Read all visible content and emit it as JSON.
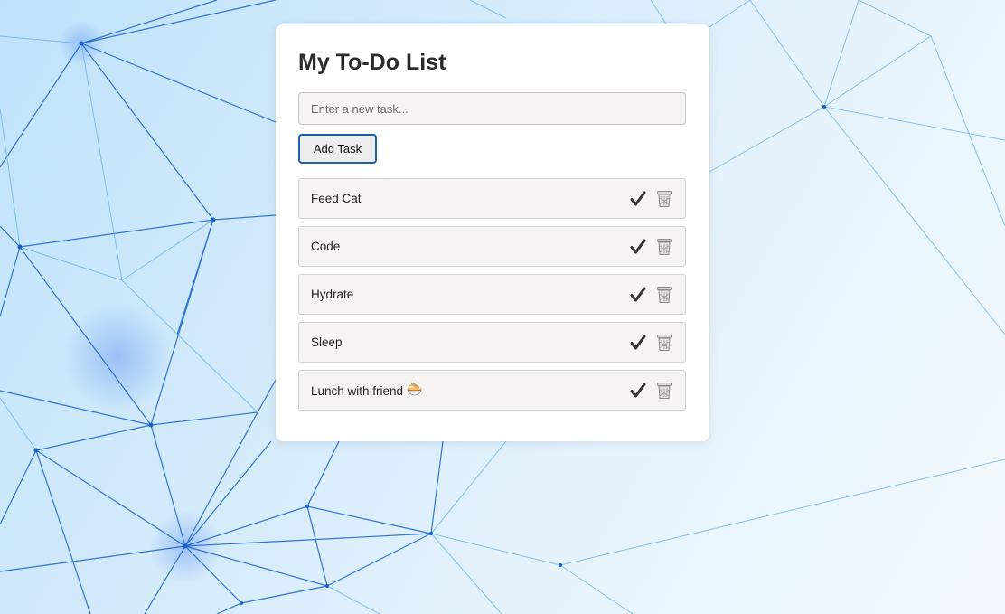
{
  "app": {
    "title": "My To-Do List"
  },
  "new_task": {
    "placeholder": "Enter a new task...",
    "value": "",
    "add_label": "Add Task"
  },
  "tasks": [
    {
      "text": "Feed Cat",
      "icons": [
        "check-icon",
        "trash-icon"
      ]
    },
    {
      "text": "Code",
      "icons": [
        "check-icon",
        "trash-icon"
      ]
    },
    {
      "text": "Hydrate",
      "icons": [
        "check-icon",
        "trash-icon"
      ]
    },
    {
      "text": "Sleep",
      "icons": [
        "check-icon",
        "trash-icon"
      ]
    },
    {
      "text": "Lunch with friend",
      "trailing_icon": "noodle-bowl-icon",
      "icons": [
        "check-icon",
        "trash-icon"
      ]
    }
  ],
  "colors": {
    "accent_border": "#1f5fae",
    "card_bg": "#ffffff",
    "item_bg": "#f5f4f1",
    "check": "#333333"
  }
}
